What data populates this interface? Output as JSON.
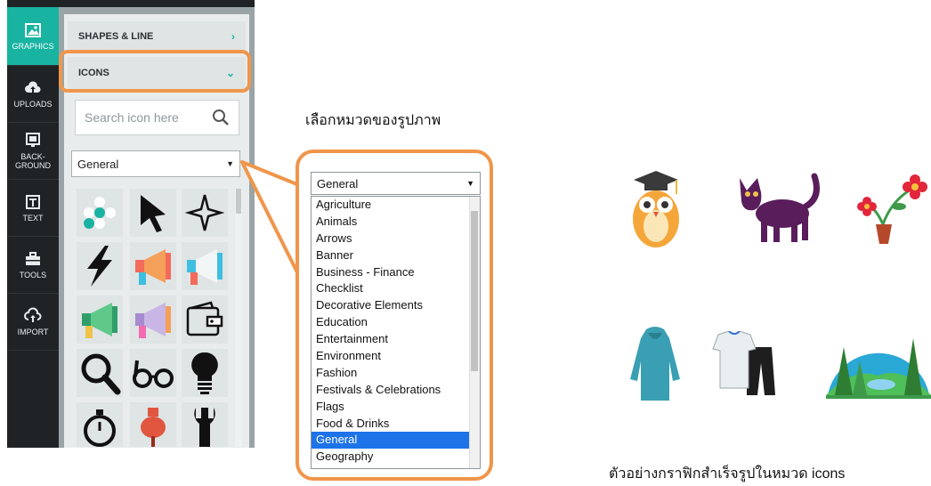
{
  "rail": {
    "items": [
      {
        "label": "GRAPHICS",
        "icon": "image-icon",
        "active": true
      },
      {
        "label": "UPLOADS",
        "icon": "cloud-upload-icon",
        "active": false
      },
      {
        "label_line1": "BACK-",
        "label_line2": "GROUND",
        "icon": "background-icon",
        "active": false
      },
      {
        "label": "TEXT",
        "icon": "text-icon",
        "active": false
      },
      {
        "label": "TOOLS",
        "icon": "toolbox-icon",
        "active": false
      },
      {
        "label": "IMPORT",
        "icon": "cloud-import-icon",
        "active": false
      }
    ]
  },
  "panel": {
    "shapes_label": "SHAPES & LINE",
    "icons_label": "ICONS",
    "search_placeholder": "Search icon here",
    "category_value": "General"
  },
  "callout": {
    "caption": "เลือกหมวดของรูปภาพ",
    "select_value": "General",
    "options": [
      "Agriculture",
      "Animals",
      "Arrows",
      "Banner",
      "Business - Finance",
      "Checklist",
      "Decorative Elements",
      "Education",
      "Entertainment",
      "Environment",
      "Fashion",
      "Festivals & Celebrations",
      "Flags",
      "Food & Drinks",
      "General",
      "Geography"
    ],
    "selected_option": "General"
  },
  "samples": {
    "caption": "ตัวอย่างกราฟิกสำเร็จรูปในหมวด icons",
    "items": [
      "owl-graduate-icon",
      "cat-icon",
      "flower-pot-icon",
      "hoodie-icon",
      "shirt-pants-icon",
      "landscape-icon"
    ]
  },
  "colors": {
    "accent": "#19b3a2",
    "highlight": "#f0954a",
    "selected": "#1e73e8",
    "rail": "#1f2326"
  }
}
